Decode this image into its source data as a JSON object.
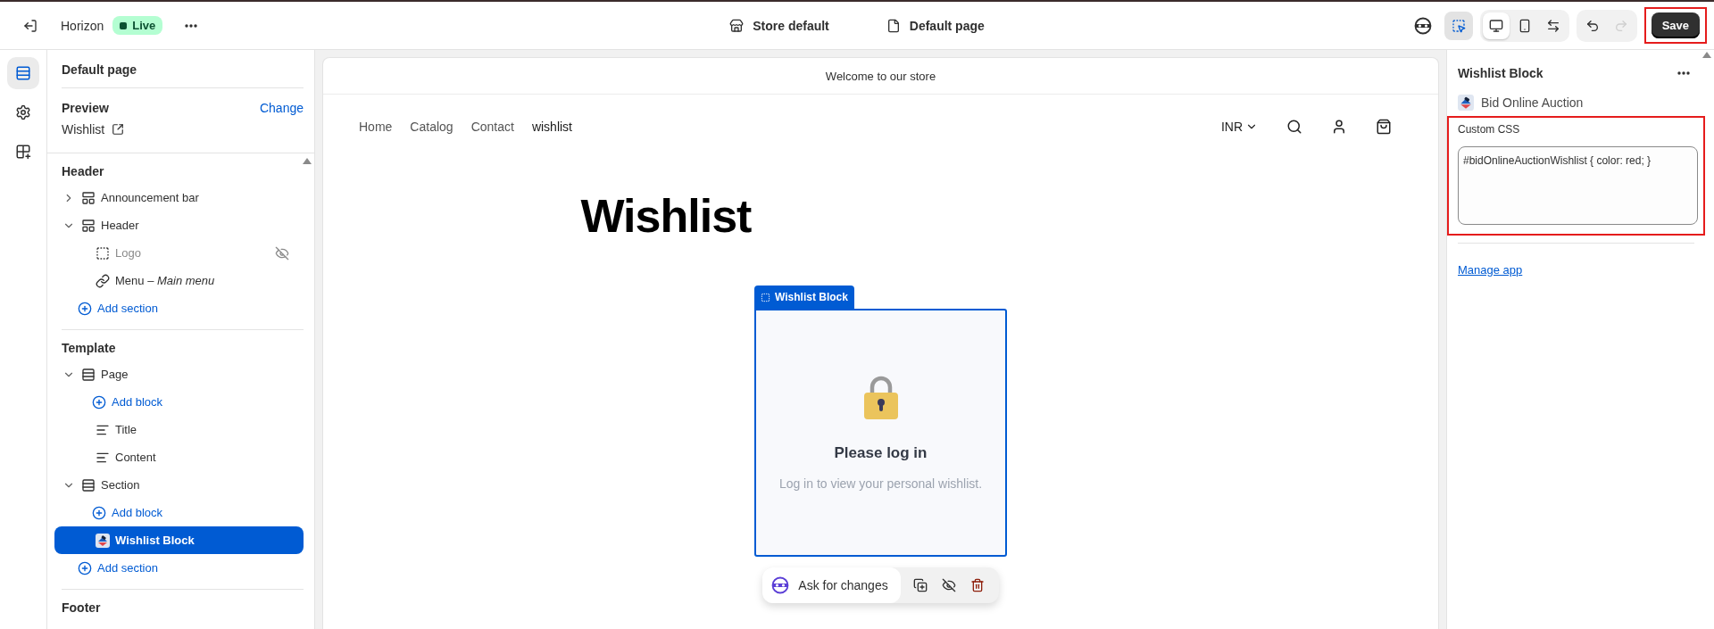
{
  "topbar": {
    "theme": "Horizon",
    "status": "Live",
    "center": [
      {
        "kind": "store",
        "label": "Store default"
      },
      {
        "kind": "page",
        "label": "Default page"
      }
    ],
    "select_tool": {
      "selected": true
    },
    "devices": [
      {
        "kind": "desktop",
        "selected": true
      },
      {
        "kind": "mobile",
        "selected": false
      },
      {
        "kind": "fullwidth",
        "selected": false
      }
    ],
    "undo": {
      "disabled": false
    },
    "redo": {
      "disabled": true
    },
    "save": {
      "label": "Save",
      "highlighted": true
    }
  },
  "rail": [
    {
      "kind": "sections",
      "selected": true
    },
    {
      "kind": "settings",
      "selected": false
    },
    {
      "kind": "apps",
      "selected": false
    }
  ],
  "sidebar": {
    "title": "Default page",
    "preview": {
      "label": "Preview",
      "action": "Change",
      "page": "Wishlist"
    },
    "groups": [
      {
        "title": "Header",
        "items": [
          {
            "kind": "header-section",
            "label": "Announcement bar",
            "expanded": false,
            "selected": false
          },
          {
            "kind": "header-section",
            "label": "Header",
            "expanded": true,
            "selected": false,
            "children": [
              {
                "kind": "logo",
                "label": "Logo",
                "hidden": true,
                "selected": false
              },
              {
                "kind": "link",
                "label": "Menu – *Main menu*",
                "hidden": false,
                "selected": false
              }
            ]
          },
          {
            "kind": "add",
            "label": "Add section"
          }
        ]
      },
      {
        "title": "Template",
        "items": [
          {
            "kind": "template-section",
            "label": "Page",
            "expanded": true,
            "selected": false,
            "children": [
              {
                "kind": "add",
                "label": "Add block"
              },
              {
                "kind": "text",
                "label": "Title",
                "selected": false
              },
              {
                "kind": "text",
                "label": "Content",
                "selected": false
              }
            ]
          },
          {
            "kind": "template-section",
            "label": "Section",
            "expanded": true,
            "selected": false,
            "children": [
              {
                "kind": "add",
                "label": "Add block"
              },
              {
                "kind": "app",
                "label": "Wishlist Block",
                "selected": true
              }
            ]
          },
          {
            "kind": "add",
            "label": "Add section"
          }
        ]
      },
      {
        "title": "Footer"
      }
    ]
  },
  "preview": {
    "announcement": "Welcome to our store",
    "nav": [
      {
        "label": "Home",
        "selected": false
      },
      {
        "label": "Catalog",
        "selected": false
      },
      {
        "label": "Contact",
        "selected": false
      },
      {
        "label": "wishlist",
        "selected": true
      }
    ],
    "currency": "INR",
    "page_title": "Wishlist",
    "block": {
      "label": "Wishlist Block",
      "heading": "Please log in",
      "message": "Log in to view your personal wishlist."
    },
    "toolbar": {
      "ask": "Ask for changes"
    }
  },
  "inspector": {
    "title": "Wishlist Block",
    "app": "Bid Online Auction",
    "custom_css": {
      "label": "Custom CSS",
      "value": "#bidOnlineAuctionWishlist { color: red; }",
      "highlighted": true
    },
    "link": "Manage app"
  }
}
